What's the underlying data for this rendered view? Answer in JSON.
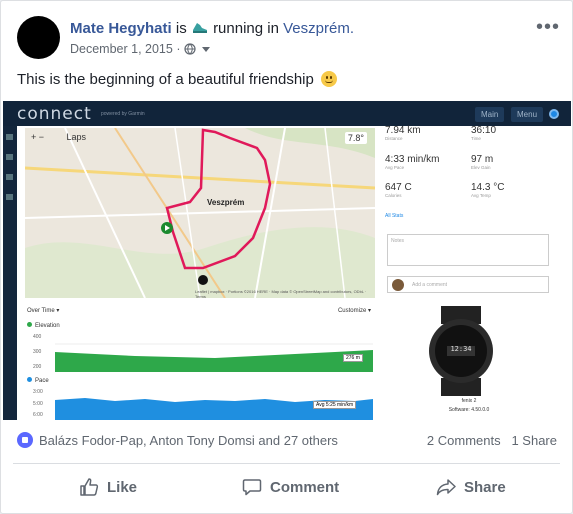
{
  "post": {
    "author": "Mate Hegyhati",
    "is_text": "is",
    "activity": "running in",
    "location": "Veszprém.",
    "date": "December 1, 2015",
    "date_sep": "·",
    "message": "This is the beginning of a beautiful friendship",
    "more_icon": "more-horizontal-icon"
  },
  "embed": {
    "logo": "connect",
    "logo_sub": "powered by Garmin",
    "btn_main": "Main",
    "btn_menu": "Menu",
    "map": {
      "zoom_controls": "+  −",
      "layers": "Laps",
      "temp": "7.8°",
      "town": "Veszprém",
      "attribution": "Leaflet | mapbox · Portions ©2016 HERE · Map data © OpenStreetMap and contributors, ODbL · Terms"
    },
    "stats": [
      {
        "value": "7.94 km",
        "label": "Distance"
      },
      {
        "value": "36:10",
        "label": "Time"
      },
      {
        "value": "4:33 min/km",
        "label": "Avg Pace"
      },
      {
        "value": "97 m",
        "label": "Elev Gain"
      },
      {
        "value": "647 C",
        "label": "Calories"
      },
      {
        "value": "14.3 °C",
        "label": "Avg Temp"
      }
    ],
    "all_stats": "All Stats",
    "notes_placeholder": "Notes",
    "comment_placeholder": "Add a comment",
    "chart": {
      "title": "Over Time ▾",
      "customize": "Customize ▾",
      "elevation_label": "Elevation",
      "elev_ticks": [
        "400",
        "300",
        "200"
      ],
      "elev_tooltip": "276 m",
      "pace_label": "Pace",
      "pace_ticks": [
        "3:00",
        "5:00",
        "6:00"
      ],
      "pace_tooltip": "Avg  5:25 min/km"
    },
    "watch_name": "fenix 2",
    "watch_software": "Software: 4.50.0.0",
    "watch_time": "12:34"
  },
  "reactions": {
    "names": "Balázs Fodor-Pap, Anton Tony Domsi and 27 others",
    "comments": "2 Comments",
    "shares": "1 Share"
  },
  "actions": {
    "like": "Like",
    "comment": "Comment",
    "share": "Share"
  },
  "colors": {
    "link": "#385898",
    "route": "#e0195a",
    "elevation": "#2ea84a",
    "pace": "#1f8fe0",
    "garmin_bar": "#11243a"
  }
}
